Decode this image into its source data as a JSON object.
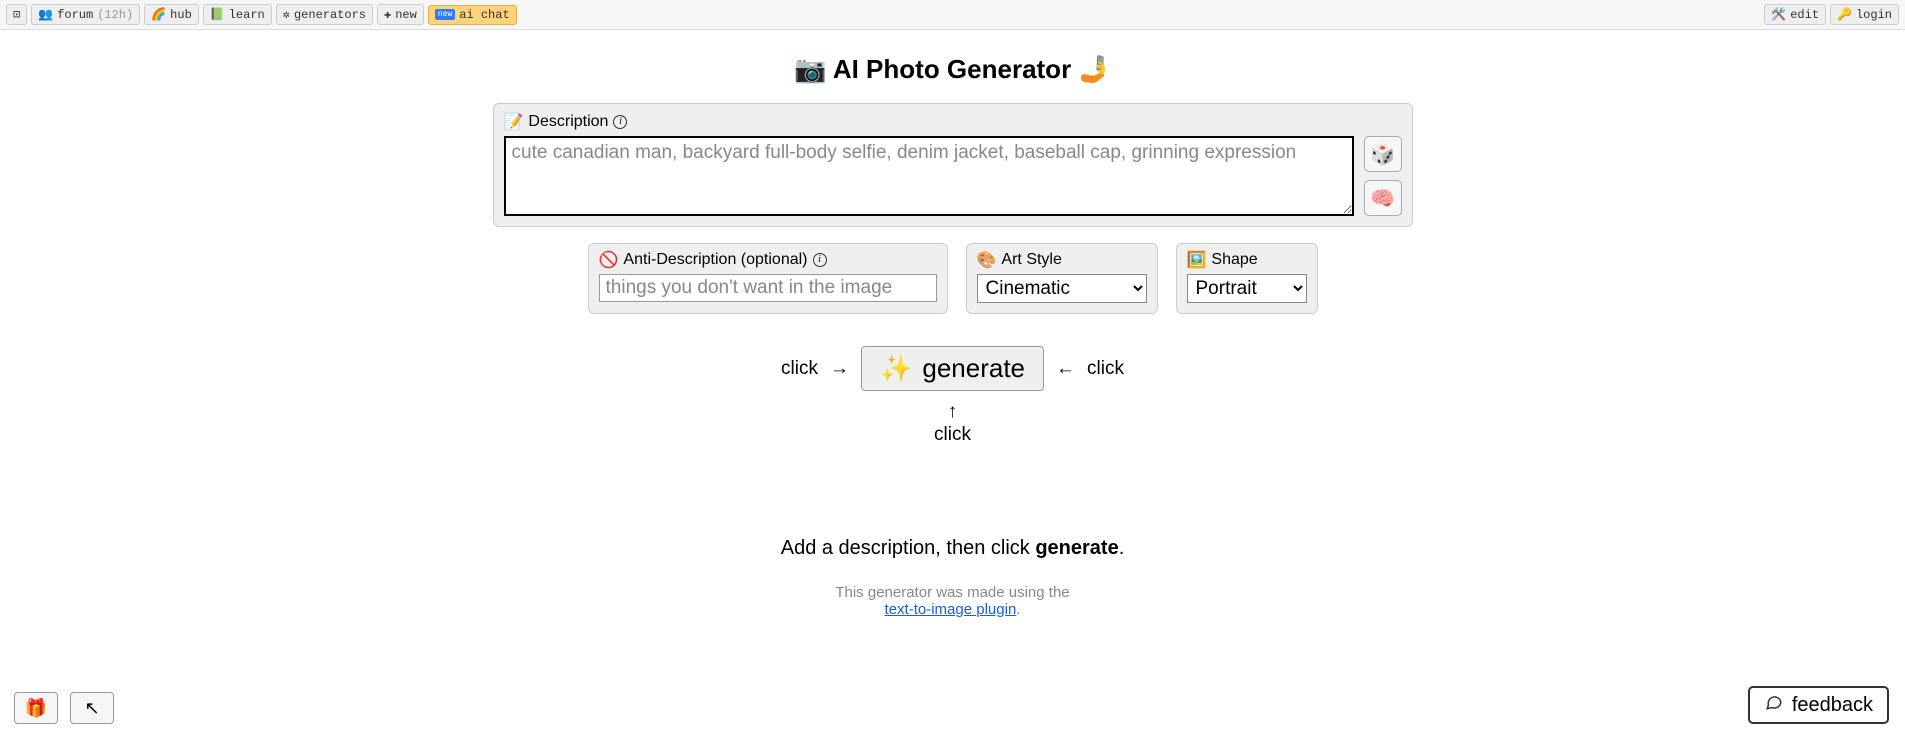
{
  "nav": {
    "perchance_icon": "⊡",
    "forum": "forum",
    "forum_time": "(12h)",
    "hub": "hub",
    "learn": "learn",
    "generators": "generators",
    "new": "new",
    "ai_chat": "ai chat",
    "edit": "edit",
    "login": "login"
  },
  "title_prefix": "📷",
  "title": "AI Photo Generator",
  "title_suffix": "🤳",
  "description": {
    "label": "Description",
    "icon": "📝",
    "placeholder": "cute canadian man, backyard full-body selfie, denim jacket, baseball cap, grinning expression",
    "value": ""
  },
  "dice_icon": "🎲",
  "brain_icon": "🧠",
  "anti": {
    "icon": "🚫",
    "label": "Anti-Description (optional)",
    "placeholder": "things you don't want in the image",
    "value": ""
  },
  "art_style": {
    "icon": "🎨",
    "label": "Art Style",
    "value": "Cinematic",
    "options": [
      "Cinematic"
    ]
  },
  "shape": {
    "icon": "🖼️",
    "label": "Shape",
    "value": "Portrait",
    "options": [
      "Portrait"
    ]
  },
  "click_hint": "click",
  "arrow_right": "→",
  "arrow_left": "←",
  "arrow_up": "↑",
  "generate_icon": "✨",
  "generate_label": "generate",
  "instruction_pre": "Add a description, then click ",
  "instruction_bold": "generate",
  "instruction_post": ".",
  "footnote_pre": "This generator was made using the ",
  "footnote_link": "text-to-image plugin",
  "footnote_post": ".",
  "gift_icon": "🎁",
  "arrow_nw": "↖",
  "feedback_icon": "💬",
  "feedback_label": "feedback",
  "chart_data": null
}
